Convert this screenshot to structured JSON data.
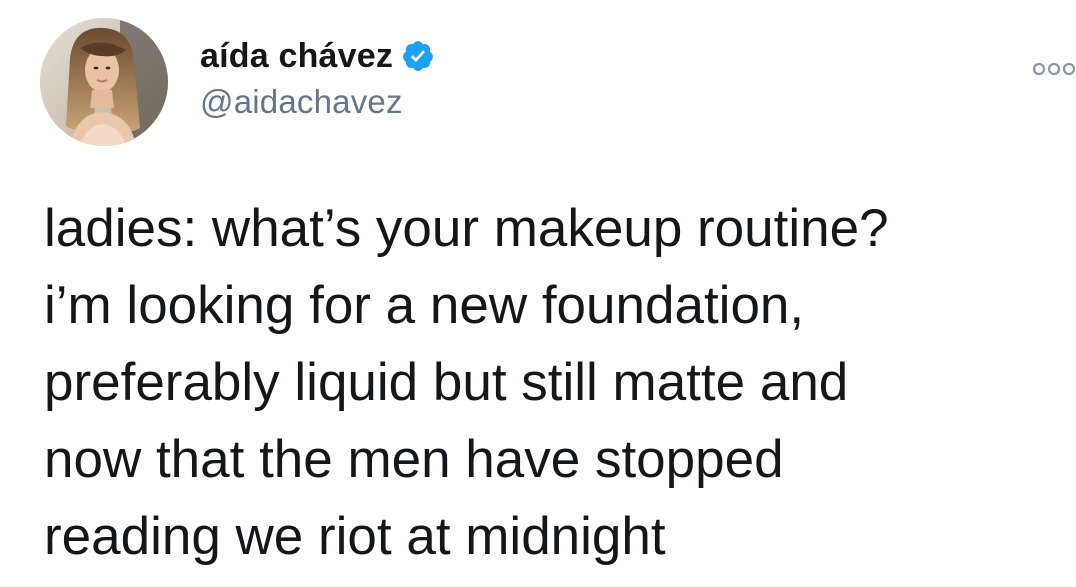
{
  "tweet": {
    "author": {
      "display_name": "aída chávez",
      "handle": "@aidachavez",
      "verified": true,
      "avatar_icon": "avatar-photo",
      "verified_icon": "verified-badge-icon"
    },
    "more_icon": "more-options-icon",
    "text_lines": [
      "ladies: what’s your makeup routine?",
      "i’m looking for a new foundation,",
      "preferably liquid but still matte and",
      "now that the men have stopped",
      "reading we riot at midnight"
    ]
  },
  "colors": {
    "text": "#14171a",
    "secondary_text": "#657786",
    "verified_blue": "#1da1f2",
    "background": "#ffffff"
  }
}
